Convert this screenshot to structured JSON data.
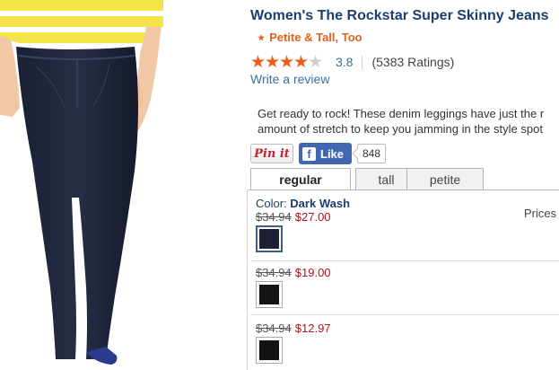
{
  "product": {
    "title": "Women's The Rockstar Super Skinny Jeans",
    "tagline": "Petite & Tall, Too",
    "tagline_icon": "star-icon",
    "rating_value": "3.8",
    "rating_stars": 3.8,
    "rating_count_text": "(5383 Ratings)",
    "write_review": "Write a review",
    "description": [
      "Get ready to rock! These denim leggings have just the r",
      "amount of stretch to keep you jamming in the style spot"
    ]
  },
  "social": {
    "pinit_label": "Pin it",
    "like_label": "Like",
    "like_icon": "facebook-icon",
    "like_count": "848"
  },
  "tabs": [
    {
      "label": "regular",
      "active": true
    },
    {
      "label": "tall",
      "active": false
    },
    {
      "label": "petite",
      "active": false
    }
  ],
  "variants": {
    "color_prefix": "Color: ",
    "color_name": "Dark Wash",
    "prices_label": "Prices",
    "rows": [
      {
        "old_price": "$34.94",
        "new_price": "$27.00",
        "swatch_color": "#1c2233",
        "selected": true
      },
      {
        "old_price": "$34.94",
        "new_price": "$19.00",
        "swatch_color": "#141414",
        "selected": false
      },
      {
        "old_price": "$34.94",
        "new_price": "$12.97",
        "swatch_color": "#121212",
        "selected": false
      }
    ]
  },
  "colors": {
    "title": "#1b3f6e",
    "accent_orange": "#e8601c",
    "link_blue": "#3a6ea5",
    "sale_red": "#b5121b",
    "facebook_blue": "#4267b2"
  }
}
